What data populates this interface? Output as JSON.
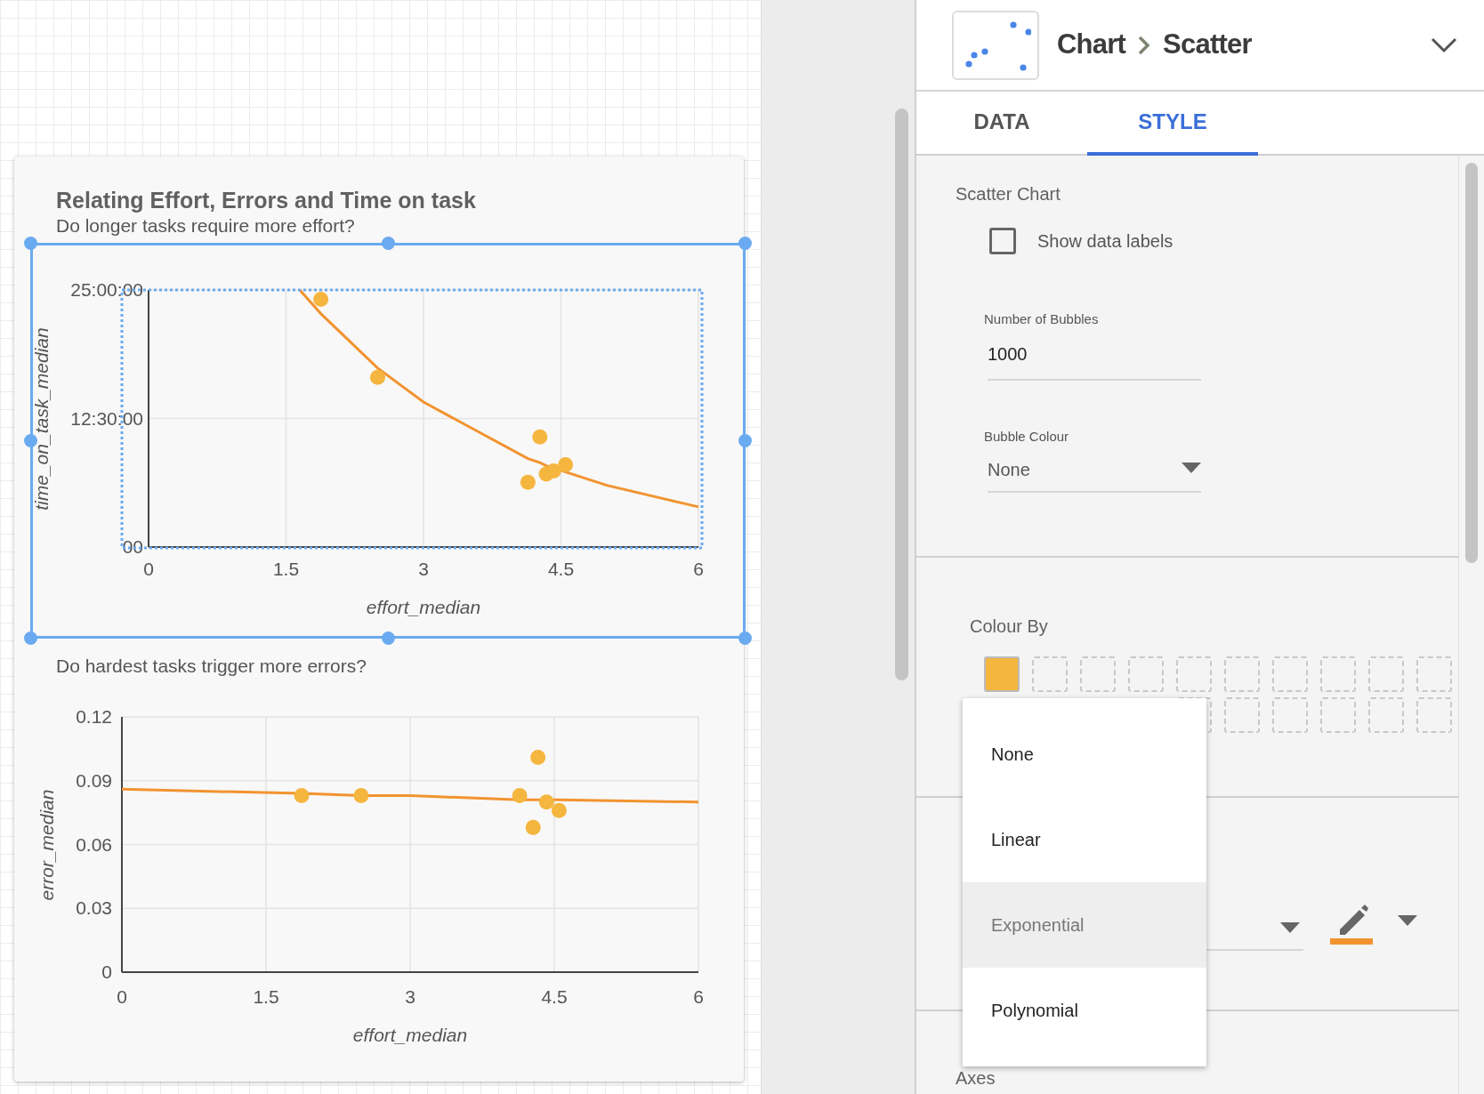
{
  "report": {
    "title": "Relating Effort, Errors and Time on task",
    "charts": [
      {
        "subtitle": "Do longer tasks require more effort?",
        "selected": true,
        "chart_data": {
          "type": "scatter",
          "xlabel": "effort_median",
          "ylabel": "time_on_task_median",
          "grid": true,
          "x": [
            1.65,
            1.88,
            2.5,
            3,
            4.14,
            4.27,
            4.34,
            4.42,
            4.55,
            5,
            6
          ],
          "series": [
            {
              "color": "#f5b63f",
              "values": [
                null,
                24.1,
                16.5,
                null,
                6.3,
                10.7,
                7.1,
                7.4,
                8.0,
                null,
                null
              ]
            },
            {
              "type": "line",
              "color": "#f29330",
              "values": [
                25,
                22.7,
                17.4,
                14.1,
                8.6,
                8.2,
                7.9,
                7.7,
                7.3,
                6.0,
                3.9
              ]
            }
          ],
          "xlim": [
            0,
            6
          ],
          "ylim": [
            0,
            25
          ],
          "xticks": [
            0,
            1.5,
            3,
            4.5,
            6
          ],
          "yticks": [
            {
              "value": 0,
              "label": "00"
            },
            {
              "value": 12.5,
              "label": "12:30:00"
            },
            {
              "value": 25,
              "label": "25:00:00"
            }
          ]
        }
      },
      {
        "subtitle": "Do hardest tasks trigger more errors?",
        "selected": false,
        "chart_data": {
          "type": "scatter",
          "xlabel": "effort_median",
          "ylabel": "error_median",
          "grid": true,
          "x": [
            0,
            1.87,
            2.49,
            3,
            4.14,
            4.28,
            4.33,
            4.42,
            4.55,
            6
          ],
          "series": [
            {
              "color": "#f5b63f",
              "values": [
                null,
                0.083,
                0.083,
                null,
                0.083,
                0.068,
                0.101,
                0.08,
                0.076,
                null
              ]
            },
            {
              "type": "line",
              "color": "#f29330",
              "values": [
                0.086,
                0.084,
                0.083,
                0.083,
                0.081,
                0.081,
                0.081,
                0.081,
                0.081,
                0.08
              ]
            }
          ],
          "xlim": [
            0,
            6
          ],
          "ylim": [
            0,
            0.12
          ],
          "xticks": [
            0,
            1.5,
            3,
            4.5,
            6
          ],
          "yticks": [
            0,
            0.03,
            0.06,
            0.09,
            0.12
          ]
        }
      }
    ]
  },
  "panel": {
    "breadcrumb": [
      "Chart",
      "Scatter"
    ],
    "tabs": [
      {
        "label": "DATA",
        "selected": false
      },
      {
        "label": "STYLE",
        "selected": true
      }
    ],
    "section_title": "Scatter Chart",
    "show_data_labels": {
      "label": "Show data labels",
      "checked": false
    },
    "number_of_bubbles": {
      "label": "Number of Bubbles",
      "value": "1000"
    },
    "bubble_colour": {
      "label": "Bubble Colour",
      "value": "None"
    },
    "colour_by": {
      "label": "Colour By",
      "swatches": [
        {
          "kind": "filled",
          "color": "#f5b63f"
        },
        {
          "kind": "empty"
        },
        {
          "kind": "empty"
        },
        {
          "kind": "empty"
        },
        {
          "kind": "empty"
        },
        {
          "kind": "empty"
        },
        {
          "kind": "empty"
        },
        {
          "kind": "empty"
        },
        {
          "kind": "empty"
        },
        {
          "kind": "empty"
        }
      ],
      "second_row": [
        {
          "kind": "empty"
        },
        {
          "kind": "empty"
        },
        {
          "kind": "empty"
        },
        {
          "kind": "empty"
        },
        {
          "kind": "empty"
        },
        {
          "kind": "empty"
        }
      ]
    },
    "axes_label": "Axes"
  },
  "trendline_menu": {
    "items": [
      {
        "label": "None",
        "selected": false
      },
      {
        "label": "Linear",
        "selected": false
      },
      {
        "label": "Exponential",
        "selected": true
      },
      {
        "label": "Polynomial",
        "selected": false
      }
    ]
  }
}
